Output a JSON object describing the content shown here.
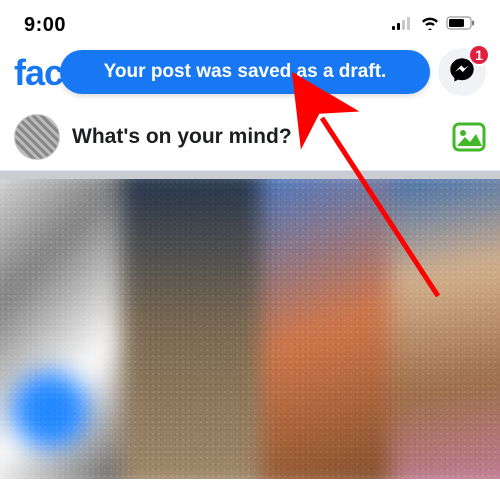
{
  "status_bar": {
    "time": "9:00"
  },
  "header": {
    "logo_text": "fac",
    "toast_text": "Your post was saved as a draft.",
    "messenger_badge": "1"
  },
  "composer": {
    "prompt": "What's on your mind?"
  }
}
